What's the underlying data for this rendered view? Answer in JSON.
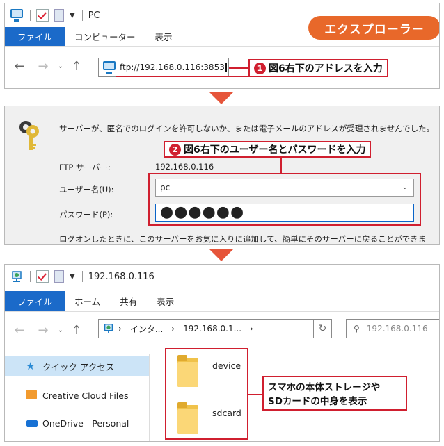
{
  "badge": "エクスプローラー",
  "explorer1": {
    "title": "PC",
    "tabs": [
      "ファイル",
      "コンピューター",
      "表示"
    ],
    "address": "ftp://192.168.0.116:3853"
  },
  "callout1": {
    "num": "1",
    "text": "図6右下のアドレスを入力"
  },
  "login": {
    "message": "サーバーが、匿名でのログインを許可しないか、または電子メールのアドレスが受理されませんでした。",
    "server_label": "FTP サーバー:",
    "server_value": "192.168.0.116",
    "user_label": "ユーザー名(U):",
    "user_value": "pc",
    "pass_label": "パスワード(P):",
    "pass_value": "●●●●●●",
    "note": "ログオンしたときに、このサーバーをお気に入りに追加して、簡単にそのサーバーに戻ることができます。"
  },
  "callout2": {
    "num": "2",
    "text": "図6右下のユーザー名とパスワードを入力"
  },
  "explorer2": {
    "title": "192.168.0.116",
    "tabs": [
      "ファイル",
      "ホーム",
      "共有",
      "表示"
    ],
    "breadcrumb": [
      "インタ...",
      "192.168.0.1..."
    ],
    "search_placeholder": "192.168.0.116",
    "sidebar": [
      "クイック アクセス",
      "Creative Cloud Files",
      "OneDrive - Personal"
    ],
    "folders": [
      "device",
      "sdcard"
    ]
  },
  "callout3": {
    "line1": "スマホの本体ストレージや",
    "line2": "SDカードの中身を表示"
  },
  "colors": {
    "accent": "#1b6ac9",
    "callout": "#d01f2f",
    "badge": "#e8682a",
    "arrow": "#e6553a"
  }
}
